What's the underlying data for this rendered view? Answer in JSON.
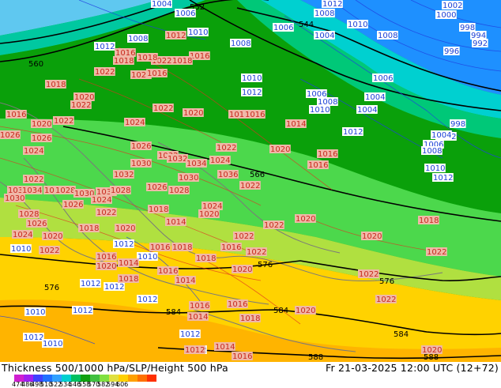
{
  "map": {
    "colors": {
      "deep_blue": "#1e90ff",
      "light_blue": "#5fc8f0",
      "cyan": "#00e0e0",
      "teal_green": "#00c878",
      "green": "#18b818",
      "dark_green": "#0aa00a",
      "light_green": "#4cd84c",
      "yellow": "#ffd200",
      "light_yellow": "#ffe04a",
      "orange": "#ffb400",
      "land_outline": "#8c8c8c"
    },
    "thickness_labels": [
      "560",
      "544",
      "552",
      "566",
      "576",
      "576",
      "576",
      "584",
      "584",
      "584",
      "588",
      "588"
    ],
    "slp_labels": [
      "1004",
      "1006",
      "1010",
      "1008",
      "1012",
      "1010",
      "1008",
      "1012",
      "1008",
      "1000",
      "996",
      "992",
      "1002",
      "998",
      "1004",
      "1006",
      "1008",
      "1012",
      "1010",
      "1008",
      "1006",
      "1014",
      "1016",
      "1018",
      "1020",
      "1022",
      "1024",
      "1026",
      "1028",
      "1030",
      "1032",
      "1034",
      "1036"
    ],
    "height_labels": [
      "1012",
      "1016",
      "1018",
      "1020",
      "1022",
      "1024",
      "1026",
      "1028",
      "1030",
      "1032",
      "1034",
      "1036"
    ]
  },
  "footer": {
    "title": "Thickness 500/1000 hPa/SLP/Height 500 hPa",
    "valid_time": "Fr 21-03-2025 12:00 UTC (12+72)",
    "scale": {
      "colors": [
        "#d020d0",
        "#a020f0",
        "#4040ff",
        "#2070ff",
        "#30a0ff",
        "#00d0d0",
        "#00c060",
        "#10a010",
        "#40c040",
        "#80e040",
        "#e0e040",
        "#ffd000",
        "#ffa000",
        "#ff7000",
        "#ff3000"
      ],
      "labels": [
        "474",
        "486",
        "498",
        "510",
        "522",
        "534",
        "546",
        "558",
        "570",
        "582",
        "594",
        "606"
      ]
    }
  }
}
